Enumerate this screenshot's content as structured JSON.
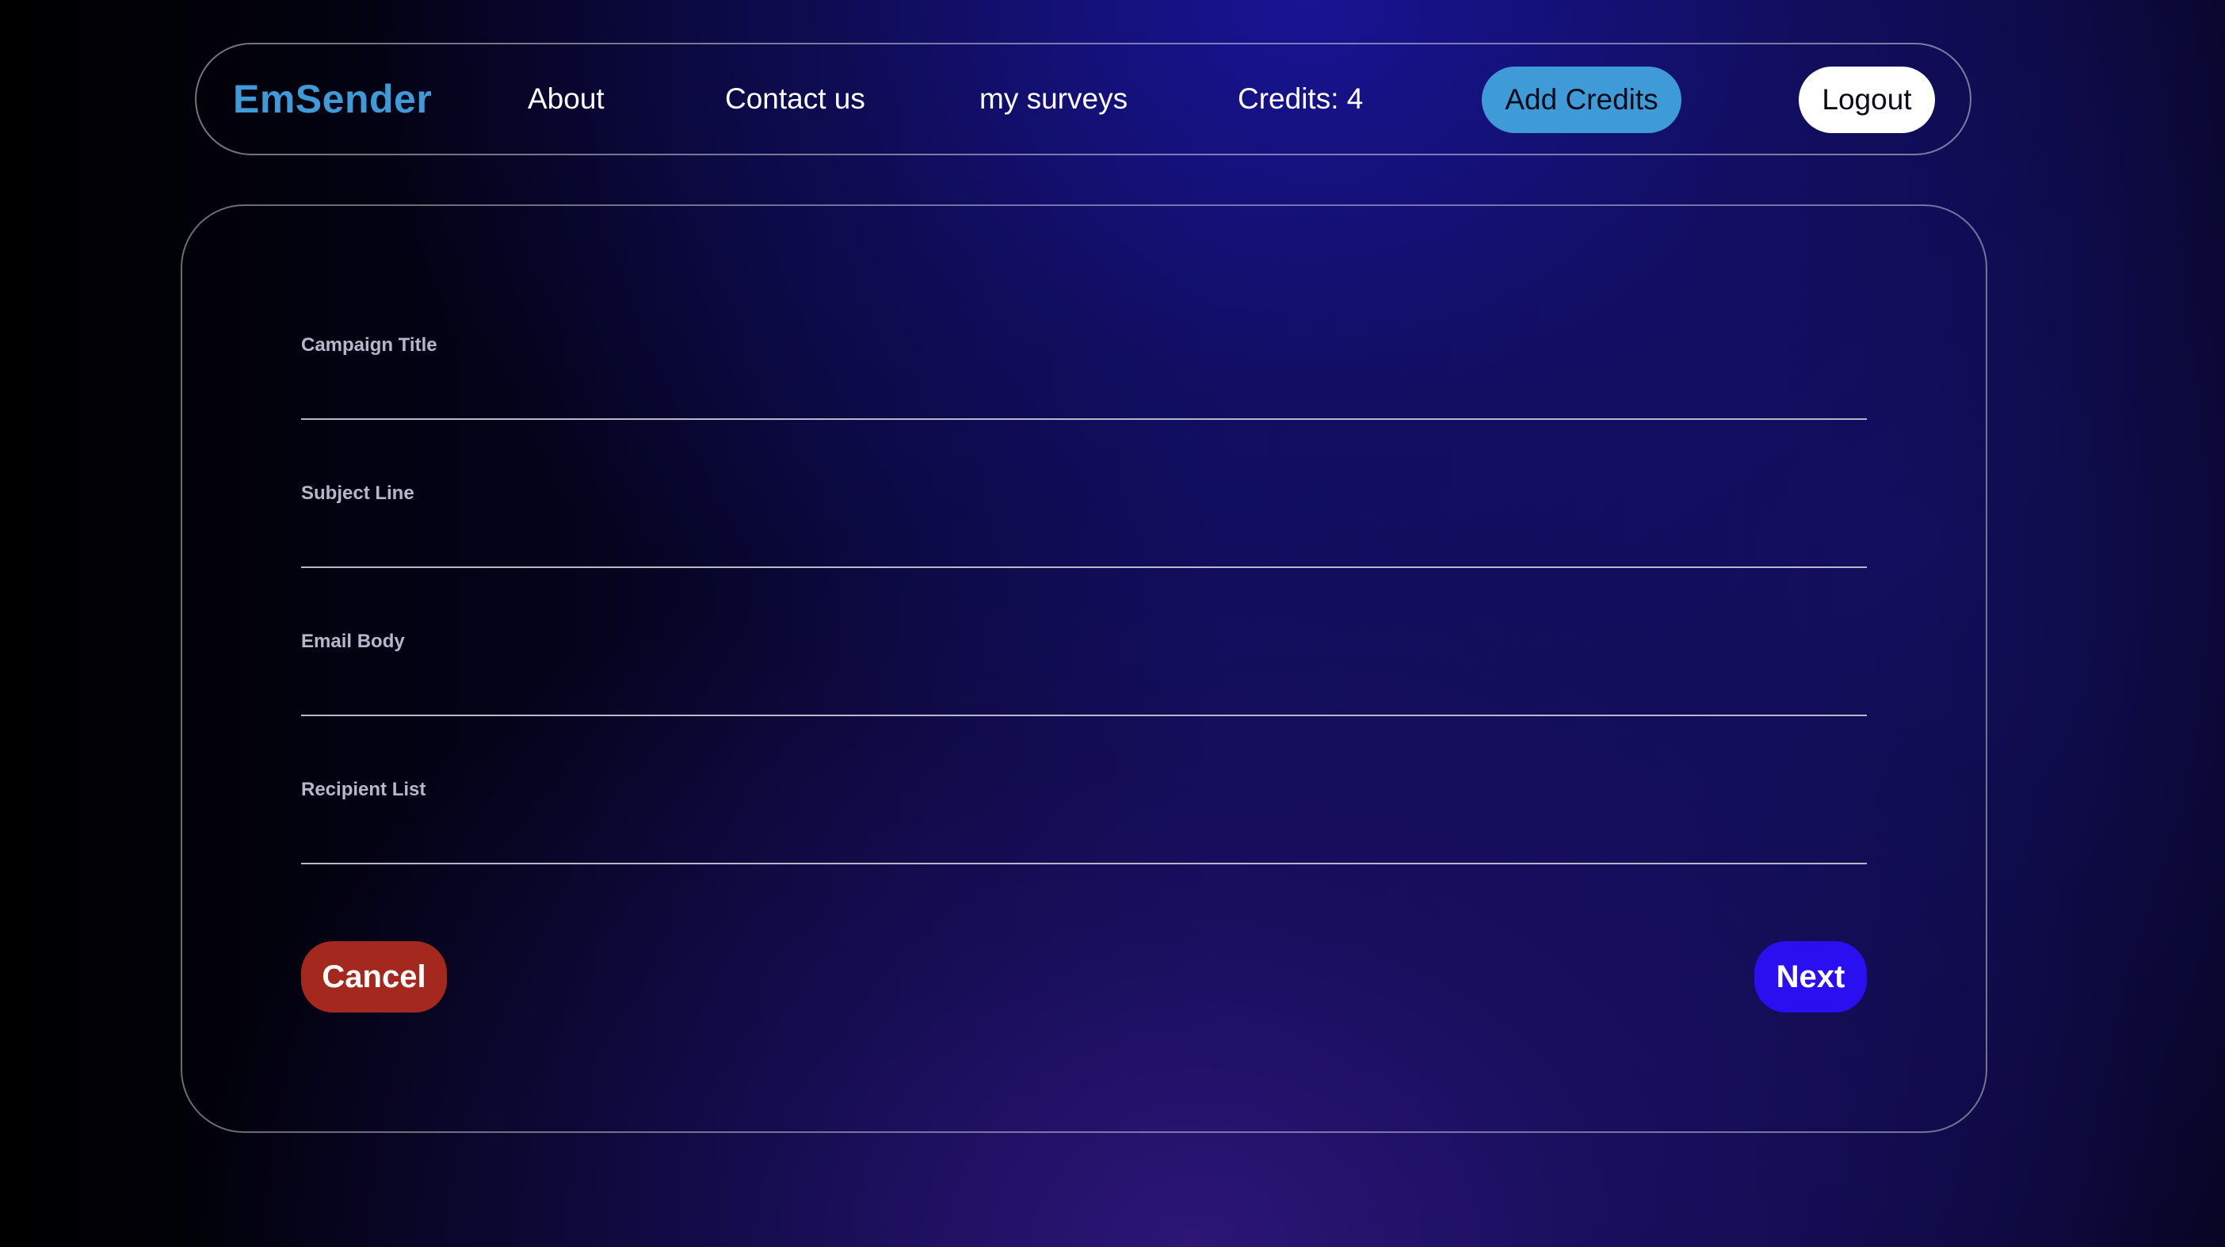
{
  "navbar": {
    "brand": "EmSender",
    "links": {
      "about": "About",
      "contact": "Contact us",
      "surveys": "my surveys"
    },
    "credits_text": "Credits: 4",
    "add_credits_label": "Add Credits",
    "logout_label": "Logout"
  },
  "form": {
    "fields": [
      {
        "label": "Campaign Title",
        "value": ""
      },
      {
        "label": "Subject Line",
        "value": ""
      },
      {
        "label": "Email Body",
        "value": ""
      },
      {
        "label": "Recipient List",
        "value": ""
      }
    ],
    "cancel_label": "Cancel",
    "next_label": "Next"
  },
  "colors": {
    "brand": "#3f9ad8",
    "add_credits_bg": "#3f9ad8",
    "logout_bg": "#ffffff",
    "cancel_bg": "#a5281f",
    "next_bg": "#2a0ff0"
  }
}
